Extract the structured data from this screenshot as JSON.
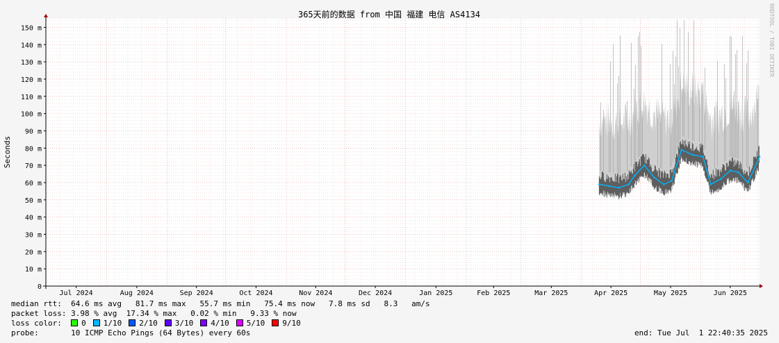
{
  "chart_data": {
    "type": "line",
    "title": "365天前的数据 from 中国 福建 电信 AS4134",
    "ylabel": "Seconds",
    "watermark": "RRDTOOL / TOBI OETIKER",
    "ylim": [
      0,
      155
    ],
    "yticks": [
      {
        "value": 0,
        "label": "0"
      },
      {
        "value": 10,
        "label": "10 m"
      },
      {
        "value": 20,
        "label": "20 m"
      },
      {
        "value": 30,
        "label": "30 m"
      },
      {
        "value": 40,
        "label": "40 m"
      },
      {
        "value": 50,
        "label": "50 m"
      },
      {
        "value": 60,
        "label": "60 m"
      },
      {
        "value": 70,
        "label": "70 m"
      },
      {
        "value": 80,
        "label": "80 m"
      },
      {
        "value": 90,
        "label": "90 m"
      },
      {
        "value": 100,
        "label": "100 m"
      },
      {
        "value": 110,
        "label": "110 m"
      },
      {
        "value": 120,
        "label": "120 m"
      },
      {
        "value": 130,
        "label": "130 m"
      },
      {
        "value": 140,
        "label": "140 m"
      },
      {
        "value": 150,
        "label": "150 m"
      }
    ],
    "xlim": [
      "2024-07-01",
      "2025-07-01"
    ],
    "xticks": [
      "Jul 2024",
      "Aug 2024",
      "Sep 2024",
      "Oct 2024",
      "Nov 2024",
      "Dec 2024",
      "Jan 2025",
      "Feb 2025",
      "Mar 2025",
      "Apr 2025",
      "May 2025",
      "Jun 2025"
    ],
    "grid": true,
    "series": [
      {
        "name": "median rtt",
        "color": "#00b4ff",
        "x": [
          "2025-04-10",
          "2025-04-15",
          "2025-04-20",
          "2025-04-25",
          "2025-04-28",
          "2025-05-03",
          "2025-05-08",
          "2025-05-13",
          "2025-05-17",
          "2025-05-22",
          "2025-05-28",
          "2025-06-02",
          "2025-06-06",
          "2025-06-11",
          "2025-06-16",
          "2025-06-20",
          "2025-06-25",
          "2025-07-01"
        ],
        "y": [
          59,
          58,
          57,
          59,
          64,
          70,
          63,
          59,
          61,
          79,
          76,
          75,
          59,
          62,
          67,
          66,
          60,
          75
        ]
      }
    ]
  },
  "stats": {
    "median_rtt": {
      "label": "median rtt:",
      "values": "64.6 ms avg   81.7 ms max   55.7 ms min   75.4 ms now   7.8 ms sd   8.3   am/s"
    },
    "packet_loss": {
      "label": "packet loss:",
      "values": "3.98 % avg  17.34 % max   0.02 % min   9.33 % now"
    },
    "loss_color": {
      "label": "loss color:",
      "items": [
        {
          "label": "0",
          "color": "#26ff00"
        },
        {
          "label": "1/10",
          "color": "#00b8ff"
        },
        {
          "label": "2/10",
          "color": "#0059ff"
        },
        {
          "label": "3/10",
          "color": "#5e00ff"
        },
        {
          "label": "4/10",
          "color": "#7e00ff"
        },
        {
          "label": "5/10",
          "color": "#dd00ff"
        },
        {
          "label": "9/10",
          "color": "#ff0000"
        }
      ]
    },
    "probe": {
      "label": "probe:",
      "values": "10 ICMP Echo Pings (64 Bytes) every 60s"
    },
    "end": "end: Tue Jul  1 22:40:35 2025"
  }
}
